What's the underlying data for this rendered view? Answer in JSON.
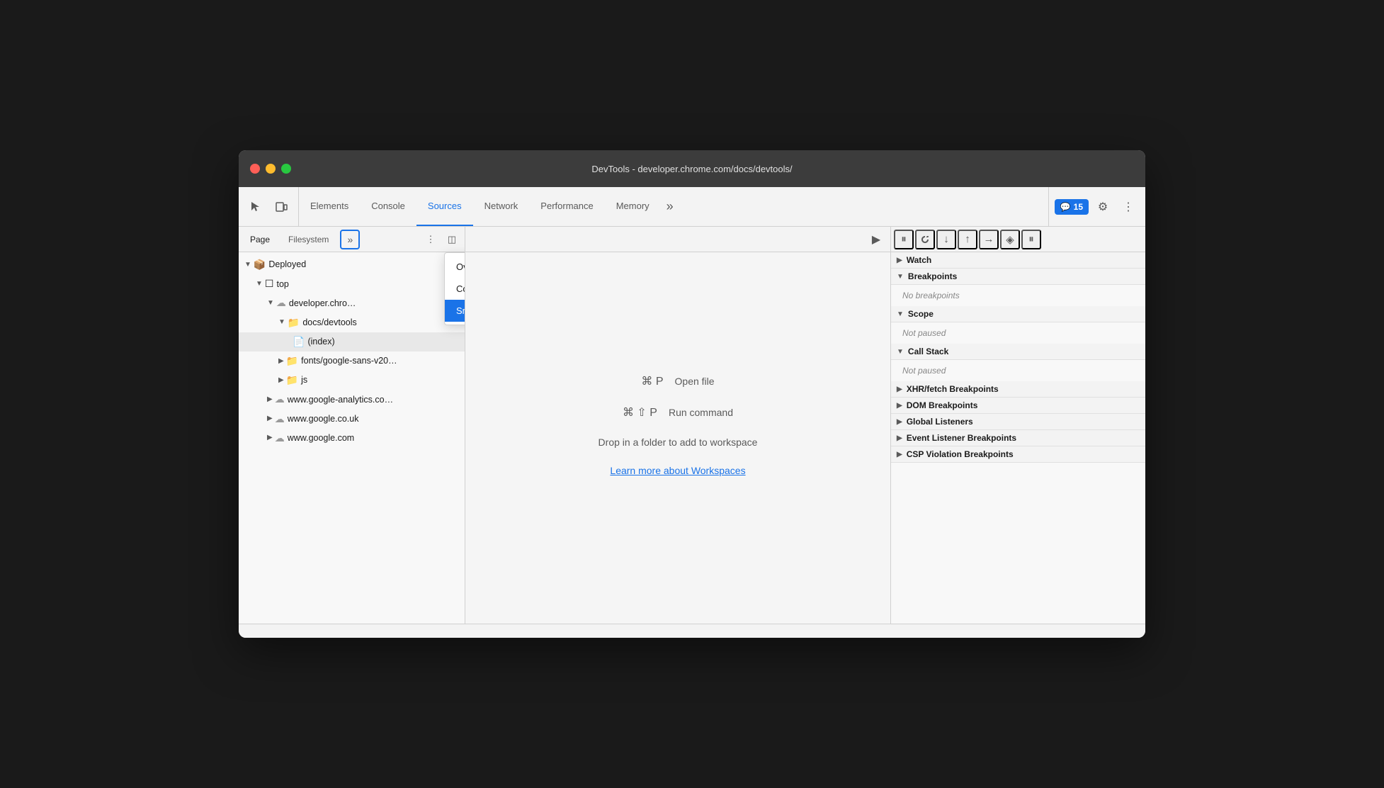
{
  "titlebar": {
    "title": "DevTools - developer.chrome.com/docs/devtools/"
  },
  "toolbar": {
    "tabs": [
      {
        "id": "elements",
        "label": "Elements",
        "active": false
      },
      {
        "id": "console",
        "label": "Console",
        "active": false
      },
      {
        "id": "sources",
        "label": "Sources",
        "active": true
      },
      {
        "id": "network",
        "label": "Network",
        "active": false
      },
      {
        "id": "performance",
        "label": "Performance",
        "active": false
      },
      {
        "id": "memory",
        "label": "Memory",
        "active": false
      }
    ],
    "more_tabs": "»",
    "badge_icon": "💬",
    "badge_count": "15",
    "settings_icon": "⚙",
    "more_icon": "⋮"
  },
  "sidebar": {
    "tabs": [
      {
        "id": "page",
        "label": "Page",
        "active": true
      },
      {
        "id": "filesystem",
        "label": "Filesystem",
        "active": false
      }
    ],
    "more_btn": "»",
    "more_icon": "⋮",
    "collapse_icon": "◫",
    "tree": [
      {
        "id": "deployed",
        "label": "Deployed",
        "indent": 0,
        "type": "root",
        "expanded": true
      },
      {
        "id": "top",
        "label": "top",
        "indent": 1,
        "type": "frame",
        "expanded": true
      },
      {
        "id": "developer-chrome",
        "label": "developer.chro…",
        "indent": 2,
        "type": "globe",
        "expanded": true
      },
      {
        "id": "docs-devtools",
        "label": "docs/devtools",
        "indent": 3,
        "type": "folder",
        "expanded": true
      },
      {
        "id": "index",
        "label": "(index)",
        "indent": 4,
        "type": "file",
        "selected": true
      },
      {
        "id": "fonts",
        "label": "fonts/google-sans-v20…",
        "indent": 3,
        "type": "folder",
        "expanded": false
      },
      {
        "id": "js",
        "label": "js",
        "indent": 3,
        "type": "folder",
        "expanded": false
      },
      {
        "id": "google-analytics",
        "label": "www.google-analytics.co…",
        "indent": 2,
        "type": "globe",
        "expanded": false
      },
      {
        "id": "google-co-uk",
        "label": "www.google.co.uk",
        "indent": 2,
        "type": "globe",
        "expanded": false
      },
      {
        "id": "google-com",
        "label": "www.google.com",
        "indent": 2,
        "type": "globe",
        "expanded": false
      }
    ]
  },
  "dropdown": {
    "items": [
      {
        "id": "overrides",
        "label": "Overrides",
        "highlighted": false
      },
      {
        "id": "content-scripts",
        "label": "Content scripts",
        "highlighted": false
      },
      {
        "id": "snippets",
        "label": "Snippets",
        "highlighted": true
      }
    ]
  },
  "center": {
    "shortcut1_keys": "⌘ P",
    "shortcut1_desc": "Open file",
    "shortcut2_keys": "⌘ ⇧ P",
    "shortcut2_desc": "Run command",
    "drop_text": "Drop in a folder to add to workspace",
    "learn_link": "Learn more about Workspaces"
  },
  "right_panel": {
    "debug_buttons": [
      {
        "id": "pause",
        "icon": "⏸",
        "label": "Pause"
      },
      {
        "id": "step-over",
        "icon": "↺",
        "label": "Step over"
      },
      {
        "id": "step-into",
        "icon": "↓",
        "label": "Step into"
      },
      {
        "id": "step-out",
        "icon": "↑",
        "label": "Step out"
      },
      {
        "id": "step",
        "icon": "→",
        "label": "Step"
      },
      {
        "id": "deactivate",
        "icon": "◈",
        "label": "Deactivate"
      },
      {
        "id": "pause-exceptions",
        "icon": "⏸",
        "label": "Pause on exceptions"
      }
    ],
    "sections": [
      {
        "id": "watch",
        "label": "Watch",
        "expanded": false,
        "arrow": "▶"
      },
      {
        "id": "breakpoints",
        "label": "Breakpoints",
        "expanded": true,
        "arrow": "▼",
        "content": "No breakpoints"
      },
      {
        "id": "scope",
        "label": "Scope",
        "expanded": true,
        "arrow": "▼",
        "content": "Not paused"
      },
      {
        "id": "call-stack",
        "label": "Call Stack",
        "expanded": true,
        "arrow": "▼",
        "content": "Not paused"
      },
      {
        "id": "xhr-breakpoints",
        "label": "XHR/fetch Breakpoints",
        "expanded": false,
        "arrow": "▶"
      },
      {
        "id": "dom-breakpoints",
        "label": "DOM Breakpoints",
        "expanded": false,
        "arrow": "▶"
      },
      {
        "id": "global-listeners",
        "label": "Global Listeners",
        "expanded": false,
        "arrow": "▶"
      },
      {
        "id": "event-listener-breakpoints",
        "label": "Event Listener Breakpoints",
        "expanded": false,
        "arrow": "▶"
      },
      {
        "id": "csp-violation-breakpoints",
        "label": "CSP Violation Breakpoints",
        "expanded": false,
        "arrow": "▶"
      }
    ]
  }
}
